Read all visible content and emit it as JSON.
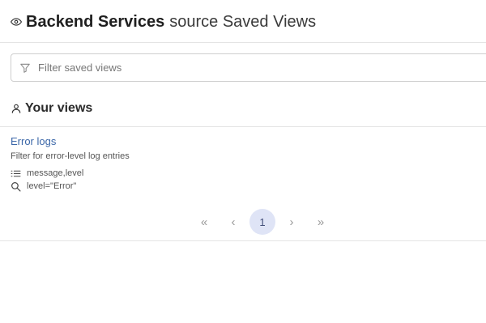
{
  "header": {
    "icon": "eye-icon",
    "title_strong": "Backend Services",
    "title_rest": "source Saved Views"
  },
  "filter": {
    "icon": "filter-icon",
    "placeholder": "Filter saved views",
    "value": ""
  },
  "section": {
    "icon": "user-icon",
    "title": "Your views"
  },
  "views": [
    {
      "name": "Error logs",
      "description": "Filter for error-level log entries",
      "columns_icon": "list-icon",
      "columns": "message,level",
      "query_icon": "search-icon",
      "query": "level=\"Error\""
    }
  ],
  "pagination": {
    "first": "«",
    "prev": "‹",
    "current_page": "1",
    "next": "›",
    "last": "»"
  },
  "colors": {
    "link": "#3b67a8",
    "active_page_bg": "#dfe4f6",
    "divider": "#e4e4e4"
  }
}
